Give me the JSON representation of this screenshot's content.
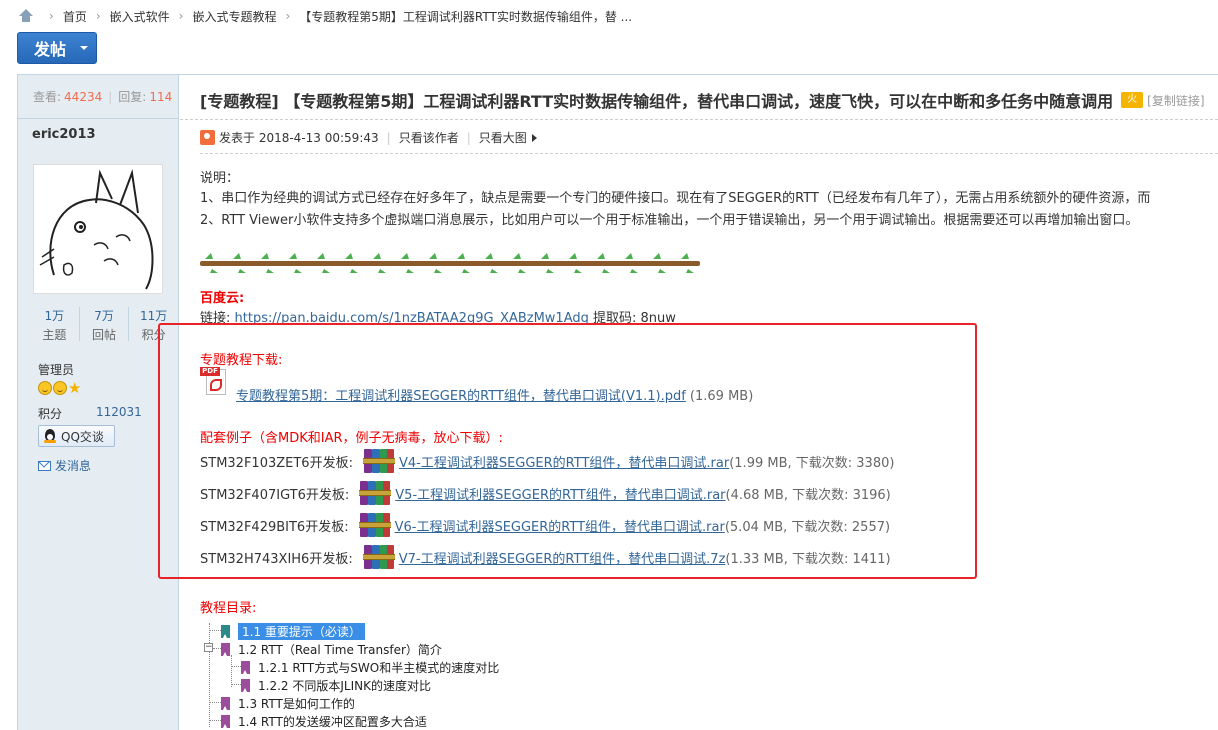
{
  "breadcrumb": {
    "items": [
      "首页",
      "嵌入式软件",
      "嵌入式专题教程",
      "【专题教程第5期】工程调试利器RTT实时数据传输组件，替 ..."
    ]
  },
  "post_button": {
    "label": "发帖"
  },
  "sidebar": {
    "views_label": "查看:",
    "views_value": "44234",
    "replies_label": "回复:",
    "replies_value": "114",
    "author": "eric2013",
    "stats": [
      {
        "value": "1万",
        "label": "主题"
      },
      {
        "value": "7万",
        "label": "回帖"
      },
      {
        "value": "11万",
        "label": "积分"
      }
    ],
    "role": "管理员",
    "points_label": "积分",
    "points_value": "112031",
    "qq_label": "QQ交谈",
    "message_label": "发消息"
  },
  "post": {
    "title": "[专题教程] 【专题教程第5期】工程调试利器RTT实时数据传输组件，替代串口调试，速度飞快，可以在中断和多任务中随意调用",
    "hot_badge": "火",
    "copy_link": "[复制链接]",
    "posted_label": "发表于 2018-4-13 00:59:43",
    "only_author": "只看该作者",
    "big_image": "只看大图",
    "desc_heading": "说明：",
    "desc_line1": "1、串口作为经典的调试方式已经存在好多年了，缺点是需要一个专门的硬件接口。现在有了SEGGER的RTT（已经发布有几年了），无需占用系统额外的硬件资源，而",
    "desc_line2": "2、RTT Viewer小软件支持多个虚拟端口消息展示，比如用户可以一个用于标准输出，一个用于错误输出，另一个用于调试输出。根据需要还可以再增加输出窗口。",
    "baidu_heading": "百度云:",
    "link_label": "链接: ",
    "link_url": "https://pan.baidu.com/s/1nzBATAA2q9G_XABzMw1Adg",
    "extract_code": " 提取码: 8nuw",
    "download_heading": "专题教程下载:",
    "pdf_name": "专题教程第5期：工程调试利器SEGGER的RTT组件，替代串口调试(V1.1).pdf",
    "pdf_size": " (1.69 MB)",
    "examples_heading": "配套例子（含MDK和IAR，例子无病毒，放心下载）:",
    "examples": [
      {
        "board": "STM32F103ZET6开发板:",
        "file": "V4-工程调试利器SEGGER的RTT组件，替代串口调试.rar",
        "info": " (1.99 MB, 下载次数: 3380)"
      },
      {
        "board": "STM32F407IGT6开发板:",
        "file": "V5-工程调试利器SEGGER的RTT组件，替代串口调试.rar",
        "info": " (4.68 MB, 下载次数: 3196)"
      },
      {
        "board": "STM32F429BIT6开发板:",
        "file": "V6-工程调试利器SEGGER的RTT组件，替代串口调试.rar",
        "info": " (5.04 MB, 下载次数: 2557)"
      },
      {
        "board": "STM32H743XIH6开发板:",
        "file": "V7-工程调试利器SEGGER的RTT组件，替代串口调试.7z",
        "info": " (1.33 MB, 下载次数: 1411)"
      }
    ],
    "toc_heading": "教程目录:",
    "toc": [
      "1.1 重要提示（必读）",
      "1.2 RTT（Real Time Transfer）简介",
      "1.2.1 RTT方式与SWO和半主模式的速度对比",
      "1.2.2 不同版本JLINK的速度对比",
      "1.3 RTT是如何工作的",
      "1.4 RTT的发送缓冲区配置多大合适"
    ]
  },
  "colors": {
    "accent_blue": "#2768b9",
    "sidebar_bg": "#e5edf2",
    "highlight_red": "#e8242a",
    "link": "#336699"
  }
}
